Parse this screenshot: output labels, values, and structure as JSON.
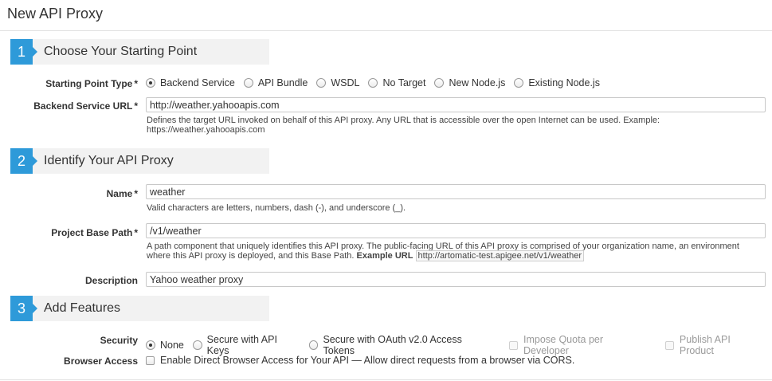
{
  "page": {
    "title": "New API Proxy"
  },
  "sections": [
    {
      "number": "1",
      "title": "Choose Your Starting Point"
    },
    {
      "number": "2",
      "title": "Identify Your API Proxy"
    },
    {
      "number": "3",
      "title": "Add Features"
    }
  ],
  "starting_point": {
    "label": "Starting Point Type",
    "required_mark": "*",
    "options": [
      "Backend Service",
      "API Bundle",
      "WSDL",
      "No Target",
      "New Node.js",
      "Existing Node.js"
    ],
    "selected": "Backend Service"
  },
  "backend_url": {
    "label": "Backend Service URL",
    "required_mark": "*",
    "value": "http://weather.yahooapis.com",
    "help_line1": "Defines the target URL invoked on behalf of this API proxy. Any URL that is accessible over the open Internet can be used. Example:",
    "help_line2": "https://weather.yahooapis.com"
  },
  "name": {
    "label": "Name",
    "required_mark": "*",
    "value": "weather",
    "help": "Valid characters are letters, numbers, dash (-), and underscore (_)."
  },
  "base_path": {
    "label": "Project Base Path",
    "required_mark": "*",
    "value": "/v1/weather",
    "help_line1": "A path component that uniquely identifies this API proxy. The public-facing URL of this API proxy is comprised of your organization name, an environment",
    "help_line2": "where this API proxy is deployed, and this Base Path.",
    "example_label": "Example URL",
    "example_url": "http://artomatic-test.apigee.net/v1/weather"
  },
  "description": {
    "label": "Description",
    "value": "Yahoo weather proxy"
  },
  "security": {
    "label": "Security",
    "options": [
      "None",
      "Secure with API Keys",
      "Secure with OAuth v2.0 Access Tokens"
    ],
    "selected": "None",
    "checkboxes": [
      "Impose Quota per Developer",
      "Publish API Product"
    ]
  },
  "browser_access": {
    "label": "Browser Access",
    "checkbox_label": "Enable Direct Browser Access for Your API — Allow direct requests from a browser via CORS."
  },
  "colors": {
    "accent": "#2e9ad9",
    "section_bg": "#f2f2f2",
    "disabled_text": "#9a9a9a"
  },
  "icons": [
    "radio-button",
    "checkbox"
  ]
}
